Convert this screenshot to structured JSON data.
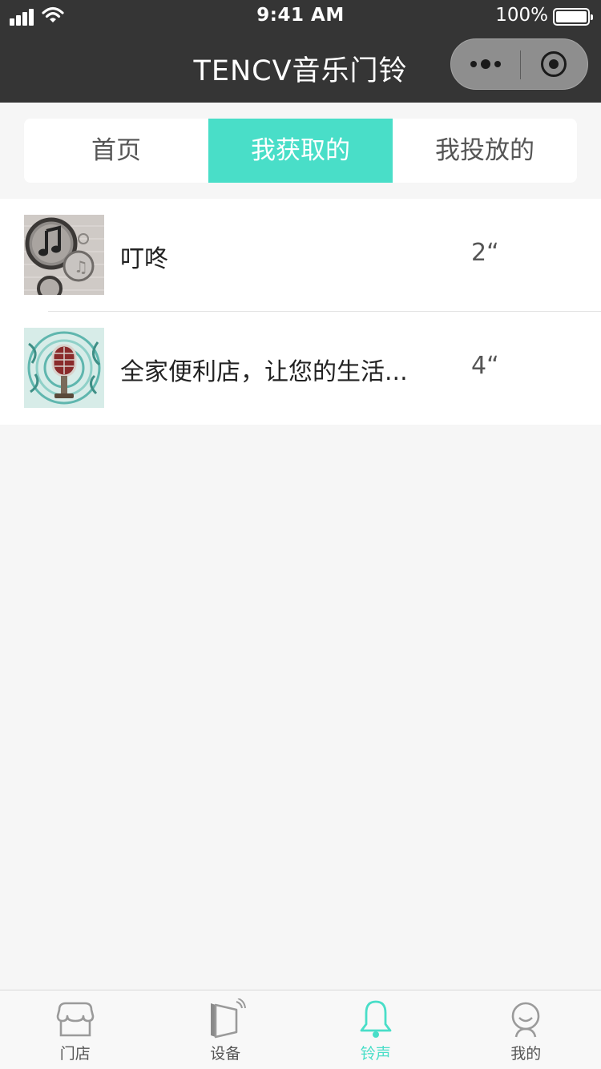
{
  "status_bar": {
    "time": "9:41 AM",
    "battery": "100%"
  },
  "header": {
    "title": "TENCV音乐门铃"
  },
  "tabs": [
    {
      "label": "首页",
      "active": false
    },
    {
      "label": "我获取的",
      "active": true
    },
    {
      "label": "我投放的",
      "active": false
    }
  ],
  "ringtones": [
    {
      "name": "叮咚",
      "duration": "2“",
      "thumb_icon": "music-note-art-icon"
    },
    {
      "name": "全家便利店，让您的生活...",
      "duration": "4“",
      "thumb_icon": "microphone-art-icon"
    }
  ],
  "tabbar": [
    {
      "label": "门店",
      "icon": "store-icon",
      "active": false
    },
    {
      "label": "设备",
      "icon": "device-icon",
      "active": false
    },
    {
      "label": "铃声",
      "icon": "bell-icon",
      "active": true
    },
    {
      "label": "我的",
      "icon": "profile-icon",
      "active": false
    }
  ],
  "colors": {
    "accent": "#49dec8",
    "header_bg": "#353535",
    "page_bg": "#f6f6f6"
  }
}
